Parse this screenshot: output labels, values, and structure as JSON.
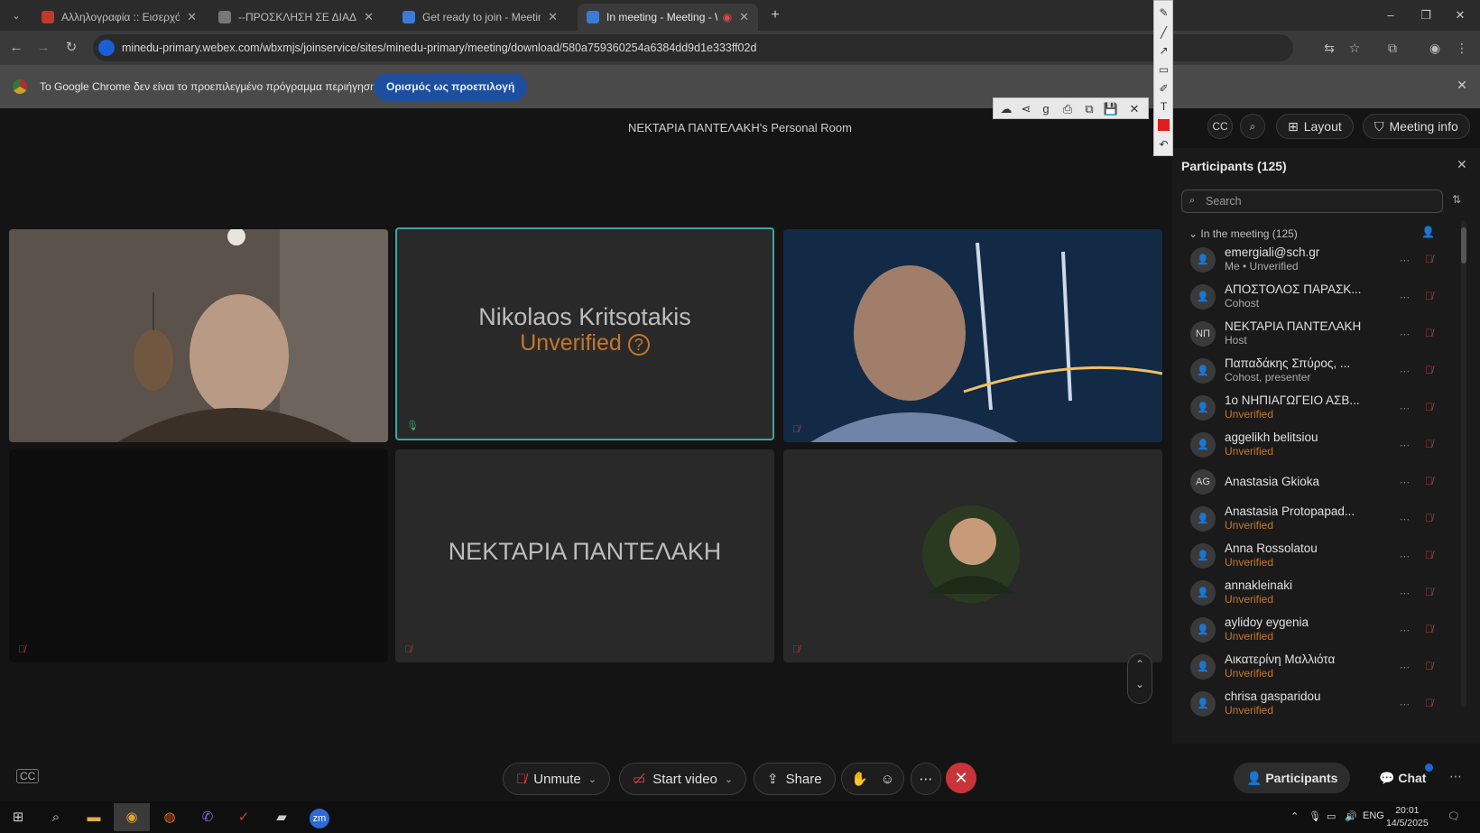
{
  "browser": {
    "tabs": [
      {
        "title": "Αλληλογραφία :: Εισερχόμενα",
        "favicon_color": "#c0392b",
        "active": false
      },
      {
        "title": "--ΠΡΟΣΚΛΗΣΗ ΣΕ ΔΙΑΔΙΚΤΥΑΚΗ",
        "favicon_color": "#777777",
        "active": false
      },
      {
        "title": "Get ready to join - Meeting - W",
        "favicon_color": "#3b7bd6",
        "active": false
      },
      {
        "title": "In meeting - Meeting - Web",
        "favicon_color": "#3b7bd6",
        "active": true
      }
    ],
    "url": "minedu-primary.webex.com/wbxmjs/joinservice/sites/minedu-primary/meeting/download/580a759360254a6384dd9d1e333ff02d",
    "infobar": {
      "text": "Το Google Chrome δεν είναι το προεπιλεγμένο πρόγραμμα περιήγησης",
      "button": "Ορισμός ως προεπιλογή"
    }
  },
  "meeting": {
    "room_title": "ΝΕΚΤΑΡΙΑ ΠΑΝΤΕΛΑΚΗ's Personal Room",
    "top_controls": {
      "layout": "Layout",
      "meeting_info": "Meeting info"
    },
    "tiles": [
      {
        "type": "video",
        "mic_muted": false
      },
      {
        "type": "name",
        "name": "Nikolaos Kritsotakis",
        "status": "Unverified",
        "active_speaker": true
      },
      {
        "type": "video",
        "mic_muted": true
      },
      {
        "type": "dark",
        "mic_muted": true
      },
      {
        "type": "name",
        "name": "ΝΕΚΤΑΡΙΑ ΠΑΝΤΕΛΑΚΗ",
        "mic_muted": true
      },
      {
        "type": "avatar",
        "mic_muted": true
      }
    ],
    "controls": {
      "unmute": "Unmute",
      "start_video": "Start video",
      "share": "Share",
      "participants": "Participants",
      "chat": "Chat"
    }
  },
  "participants_panel": {
    "title": "Participants (125)",
    "search_placeholder": "Search",
    "group_label": "In the meeting (125)",
    "items": [
      {
        "name": "emergiali@sch.gr",
        "sub": "Me • Unverified",
        "avatar": "",
        "unverified": true
      },
      {
        "name": "ΑΠΟΣΤΟΛΟΣ ΠΑΡΑΣΚ...",
        "sub": "Cohost",
        "avatar": "",
        "unverified": false
      },
      {
        "name": "ΝΕΚΤΑΡΙΑ ΠΑΝΤΕΛΑΚΗ",
        "sub": "Host",
        "avatar": "ΝΠ",
        "unverified": false
      },
      {
        "name": "Παπαδάκης Σπύρος, ...",
        "sub": "Cohost, presenter",
        "avatar": "",
        "unverified": false
      },
      {
        "name": "1ο ΝΗΠΙΑΓΩΓΕΙΟ ΑΣΒ...",
        "sub": "Unverified",
        "avatar": "",
        "unverified": true
      },
      {
        "name": "aggelikh belitsiou",
        "sub": "Unverified",
        "avatar": "",
        "unverified": true
      },
      {
        "name": "Anastasia Gkioka",
        "sub": "",
        "avatar": "AG",
        "unverified": false
      },
      {
        "name": "Anastasia Protopapad...",
        "sub": "Unverified",
        "avatar": "",
        "unverified": true
      },
      {
        "name": "Anna Rossolatou",
        "sub": "Unverified",
        "avatar": "",
        "unverified": true
      },
      {
        "name": "annakleinaki",
        "sub": "Unverified",
        "avatar": "",
        "unverified": true
      },
      {
        "name": "aylidoy eygenia",
        "sub": "Unverified",
        "avatar": "",
        "unverified": true
      },
      {
        "name": "Αικατερίνη Μαλλιότα",
        "sub": "Unverified",
        "avatar": "",
        "unverified": true
      },
      {
        "name": "chrisa gasparidou",
        "sub": "Unverified",
        "avatar": "",
        "unverified": true
      }
    ]
  },
  "taskbar": {
    "lang": "ENG",
    "time": "20:01",
    "date": "14/5/2025",
    "zm_label": "zm"
  }
}
